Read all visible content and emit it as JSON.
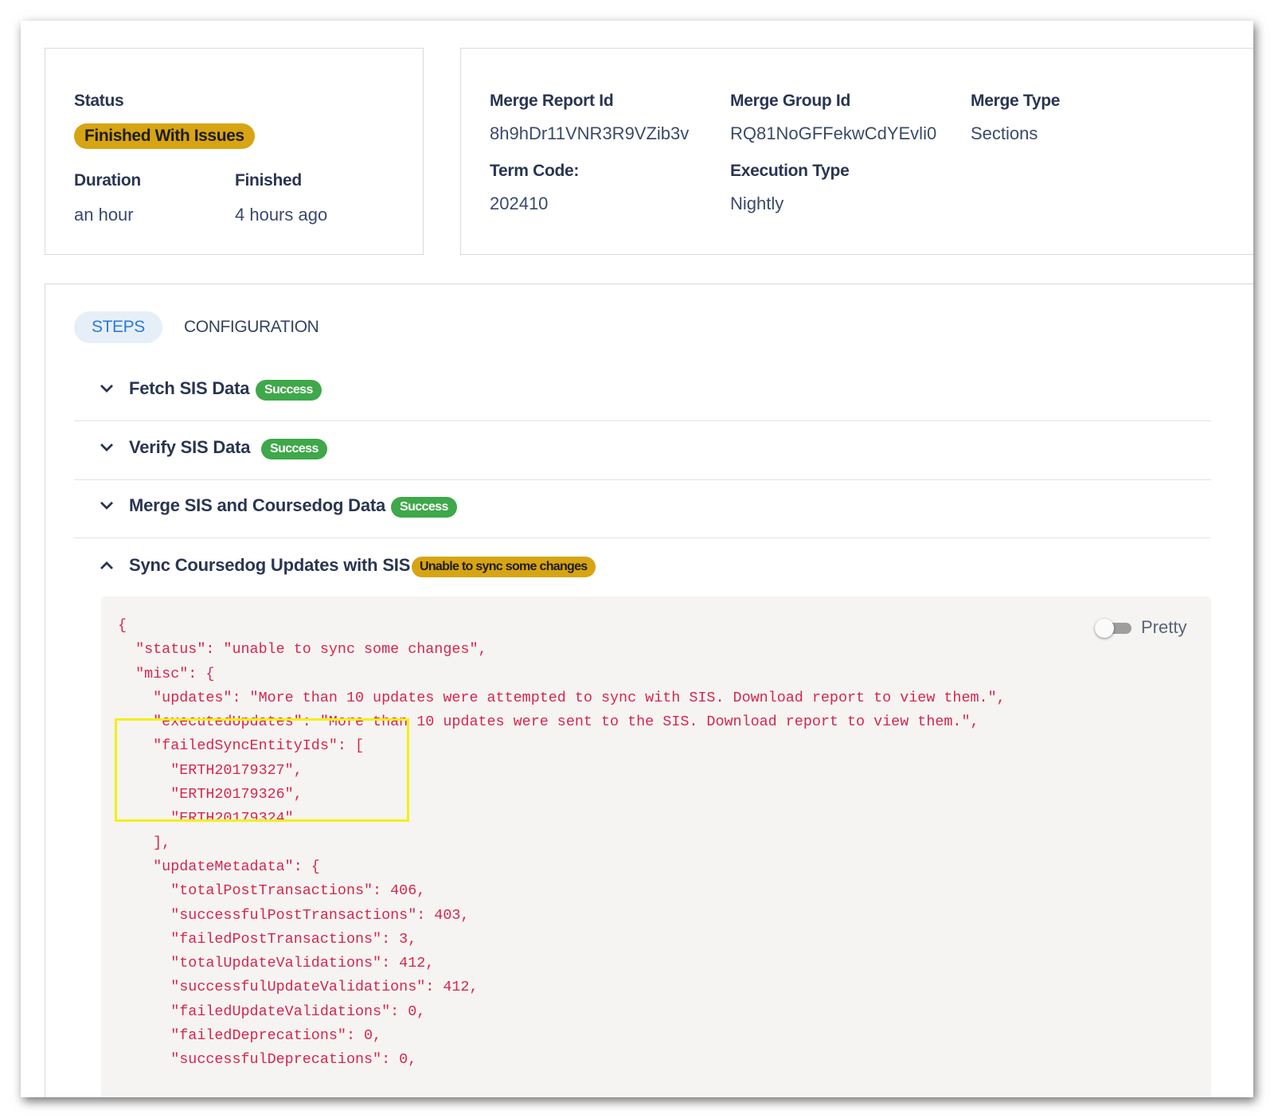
{
  "summary": {
    "status_label": "Status",
    "status_value": "Finished With Issues",
    "duration_label": "Duration",
    "duration_value": "an hour",
    "finished_label": "Finished",
    "finished_value": "4 hours ago"
  },
  "meta": {
    "merge_report_id_label": "Merge Report Id",
    "merge_report_id_value": "8h9hDr11VNR3R9VZib3v",
    "merge_group_id_label": "Merge Group Id",
    "merge_group_id_value": "RQ81NoGFFekwCdYEvli0",
    "merge_type_label": "Merge Type",
    "merge_type_value": "Sections",
    "term_code_label": "Term Code:",
    "term_code_value": "202410",
    "execution_type_label": "Execution Type",
    "execution_type_value": "Nightly"
  },
  "tabs": {
    "steps": "STEPS",
    "configuration": "CONFIGURATION"
  },
  "steps": [
    {
      "title": "Fetch SIS Data",
      "badge": "Success",
      "expanded": false
    },
    {
      "title": "Verify SIS Data",
      "badge": "Success",
      "expanded": false
    },
    {
      "title": "Merge SIS and Coursedog Data",
      "badge": "Success",
      "expanded": false
    },
    {
      "title": "Sync Coursedog Updates with SIS",
      "badge": "Unable to sync some changes",
      "expanded": true
    }
  ],
  "json_view": {
    "toggle_label": "Pretty",
    "pretty_on": false,
    "lines": [
      "{",
      "  \"status\": \"unable to sync some changes\",",
      "  \"misc\": {",
      "    \"updates\": \"More than 10 updates were attempted to sync with SIS. Download report to view them.\",",
      "    \"executedUpdates\": \"More than 10 updates were sent to the SIS. Download report to view them.\",",
      "    \"failedSyncEntityIds\": [",
      "      \"ERTH20179327\",",
      "      \"ERTH20179326\",",
      "      \"ERTH20179324\"",
      "    ],",
      "    \"updateMetadata\": {",
      "      \"totalPostTransactions\": 406,",
      "      \"successfulPostTransactions\": 403,",
      "      \"failedPostTransactions\": 3,",
      "      \"totalUpdateValidations\": 412,",
      "      \"successfulUpdateValidations\": 412,",
      "      \"failedUpdateValidations\": 0,",
      "      \"failedDeprecations\": 0,",
      "      \"successfulDeprecations\": 0,"
    ]
  },
  "colors": {
    "warning": "#d7a413",
    "success": "#3ea84a",
    "accent": "#2b7cd3",
    "code": "#d6264e",
    "highlight": "#f4ef12"
  }
}
